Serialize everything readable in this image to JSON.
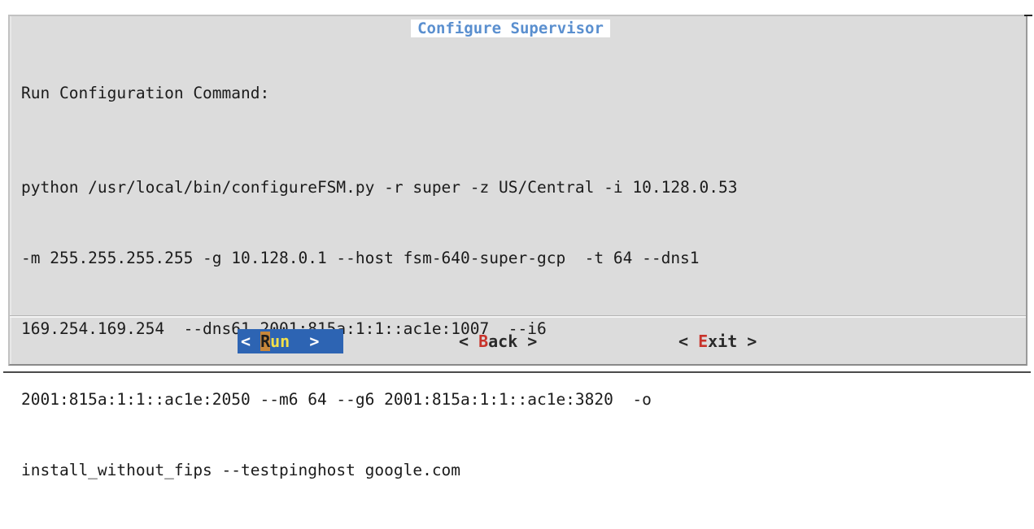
{
  "dialog": {
    "title": "Configure Supervisor",
    "heading": "Run Configuration Command:",
    "command_lines": [
      "python /usr/local/bin/configureFSM.py -r super -z US/Central -i 10.128.0.53",
      "-m 255.255.255.255 -g 10.128.0.1 --host fsm-640-super-gcp  -t 64 --dns1",
      "169.254.169.254  --dns61 2001:815a:1:1::ac1e:1007  --i6",
      "2001:815a:1:1::ac1e:2050 --m6 64 --g6 2001:815a:1:1::ac1e:3820  -o",
      "install_without_fips --testpinghost google.com"
    ]
  },
  "buttons": {
    "run": {
      "open": "< ",
      "hotkey": "R",
      "rest": "un",
      "close": "  >",
      "selected": true
    },
    "back": {
      "open": "< ",
      "hotkey": "B",
      "rest": "ack",
      "close": " >",
      "selected": false
    },
    "exit": {
      "open": "< ",
      "hotkey": "E",
      "rest": "xit",
      "close": " >",
      "selected": false
    }
  },
  "colors": {
    "dialog_background": "#dcdcdc",
    "title": "#5a8fcf",
    "selected_button": "#2d64b3",
    "hotkey": "#c8332b",
    "selected_hotkey_background": "#c8873a",
    "selected_label": "#f2e04a"
  }
}
